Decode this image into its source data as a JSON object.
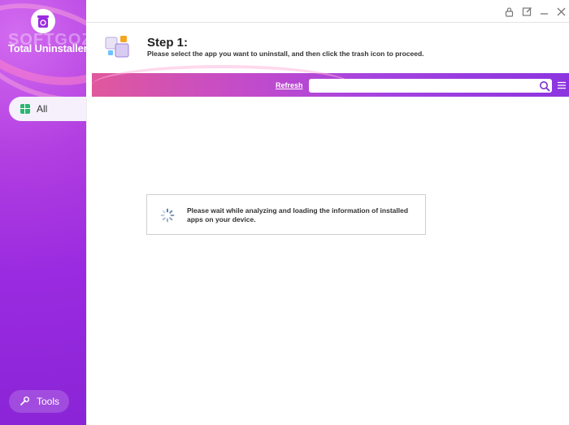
{
  "app": {
    "name": "Total Uninstaller"
  },
  "watermark": {
    "text": "SOFTGOZAR.COM"
  },
  "sidebar": {
    "all_label": "All",
    "tools_label": "Tools"
  },
  "window_controls": {
    "icons": [
      "lock-icon",
      "feedback-edit-icon",
      "minimize-icon",
      "close-icon"
    ]
  },
  "step": {
    "title": "Step 1:",
    "description": "Please select the app you want to uninstall, and then click the trash icon to proceed."
  },
  "toolbar": {
    "refresh_label": "Refresh",
    "search_placeholder": "",
    "search_value": ""
  },
  "loading": {
    "message": "Please wait while analyzing and loading the information of installed apps on your device."
  },
  "colors": {
    "accent_purple": "#9b2be0",
    "accent_pink": "#e0589c",
    "grid_icon_green": "#2bb673"
  }
}
